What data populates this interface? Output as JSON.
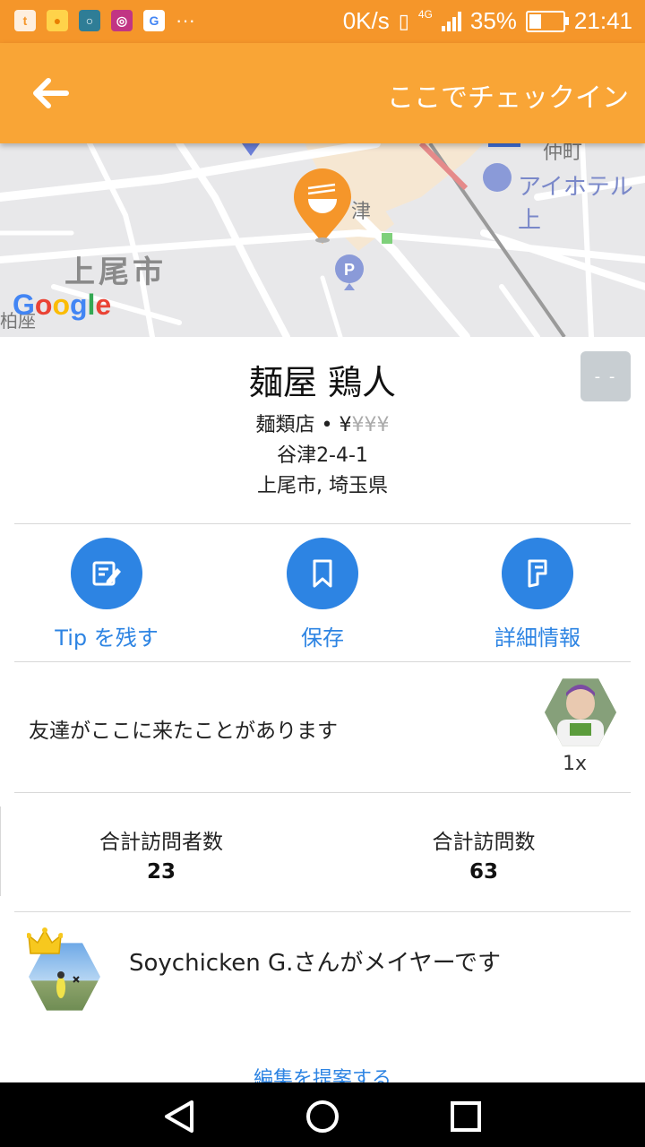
{
  "colors": {
    "status": "#f5962a",
    "appbar": "#f9a536",
    "accent": "#2d84e3",
    "pin": "#f5962a"
  },
  "statusbar": {
    "app_icons": [
      "twitter-icon",
      "fruit-app-icon",
      "circle-app-icon",
      "instagram-icon",
      "google-icon"
    ],
    "more": "···",
    "speed": "0K/s",
    "network": "4G",
    "battery": "35%",
    "battery_level": 0.35,
    "time": "21:41"
  },
  "appbar": {
    "back_icon": "arrow-left-icon",
    "checkin_label": "ここでチェックイン"
  },
  "map": {
    "labels": {
      "city": "上尾市",
      "tsu": "津",
      "hotel": "アイホテル上",
      "station": "仲町",
      "bottom": "柏座"
    },
    "google": [
      "G",
      "o",
      "o",
      "g",
      "l",
      "e"
    ]
  },
  "venue": {
    "name": "麺屋 鶏人",
    "category": "麺類店 • ",
    "price_active": "¥",
    "price_inactive": "¥¥¥",
    "address": "谷津2-4-1",
    "city": "上尾市, 埼玉県",
    "rating": "- -"
  },
  "actions": [
    {
      "label": "Tip を残す",
      "icon": "edit-note-icon"
    },
    {
      "label": "保存",
      "icon": "bookmark-icon"
    },
    {
      "label": "詳細情報",
      "icon": "foursquare-icon"
    }
  ],
  "friends": {
    "text": "友達がここに来たことがあります",
    "count": "1x"
  },
  "stats": [
    {
      "title": "合計訪問者数",
      "value": "23"
    },
    {
      "title": "合計訪問数",
      "value": "63"
    }
  ],
  "mayor": {
    "text": "Soychicken G.さんがメイヤーです"
  },
  "suggest_edit": "編集を提案する",
  "navbar": {
    "back": "triangle-back-icon",
    "home": "circle-home-icon",
    "recents": "square-recents-icon"
  }
}
